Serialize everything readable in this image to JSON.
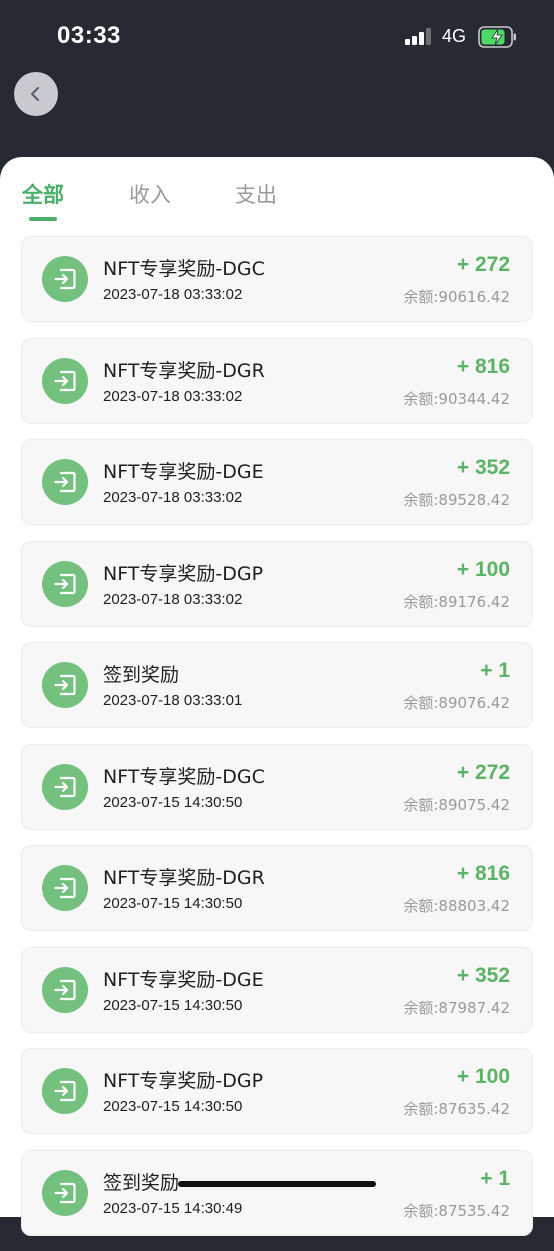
{
  "status_bar": {
    "time": "03:33",
    "network": "4G"
  },
  "tabs": [
    {
      "label": "全部",
      "active": true
    },
    {
      "label": "收入",
      "active": false
    },
    {
      "label": "支出",
      "active": false
    }
  ],
  "transactions": [
    {
      "title": "NFT专享奖励-DGC",
      "time": "2023-07-18 03:33:02",
      "amount": "+ 272",
      "balance": "余额:90616.42"
    },
    {
      "title": "NFT专享奖励-DGR",
      "time": "2023-07-18 03:33:02",
      "amount": "+ 816",
      "balance": "余额:90344.42"
    },
    {
      "title": "NFT专享奖励-DGE",
      "time": "2023-07-18 03:33:02",
      "amount": "+ 352",
      "balance": "余额:89528.42"
    },
    {
      "title": "NFT专享奖励-DGP",
      "time": "2023-07-18 03:33:02",
      "amount": "+ 100",
      "balance": "余额:89176.42"
    },
    {
      "title": "签到奖励",
      "time": "2023-07-18 03:33:01",
      "amount": "+ 1",
      "balance": "余额:89076.42"
    },
    {
      "title": "NFT专享奖励-DGC",
      "time": "2023-07-15 14:30:50",
      "amount": "+ 272",
      "balance": "余额:89075.42"
    },
    {
      "title": "NFT专享奖励-DGR",
      "time": "2023-07-15 14:30:50",
      "amount": "+ 816",
      "balance": "余额:88803.42"
    },
    {
      "title": "NFT专享奖励-DGE",
      "time": "2023-07-15 14:30:50",
      "amount": "+ 352",
      "balance": "余额:87987.42"
    },
    {
      "title": "NFT专享奖励-DGP",
      "time": "2023-07-15 14:30:50",
      "amount": "+ 100",
      "balance": "余额:87635.42"
    },
    {
      "title": "签到奖励",
      "time": "2023-07-15 14:30:49",
      "amount": "+ 1",
      "balance": "余额:87535.42"
    }
  ],
  "icons": {
    "back": "chevron-left-icon",
    "item": "sign-in-icon",
    "signal": "signal-icon",
    "battery": "battery-charging-icon"
  },
  "colors": {
    "accent": "#4caf6a",
    "header_bg": "#262a33",
    "amount": "#5bb466",
    "icon_bg": "#74c07e"
  }
}
